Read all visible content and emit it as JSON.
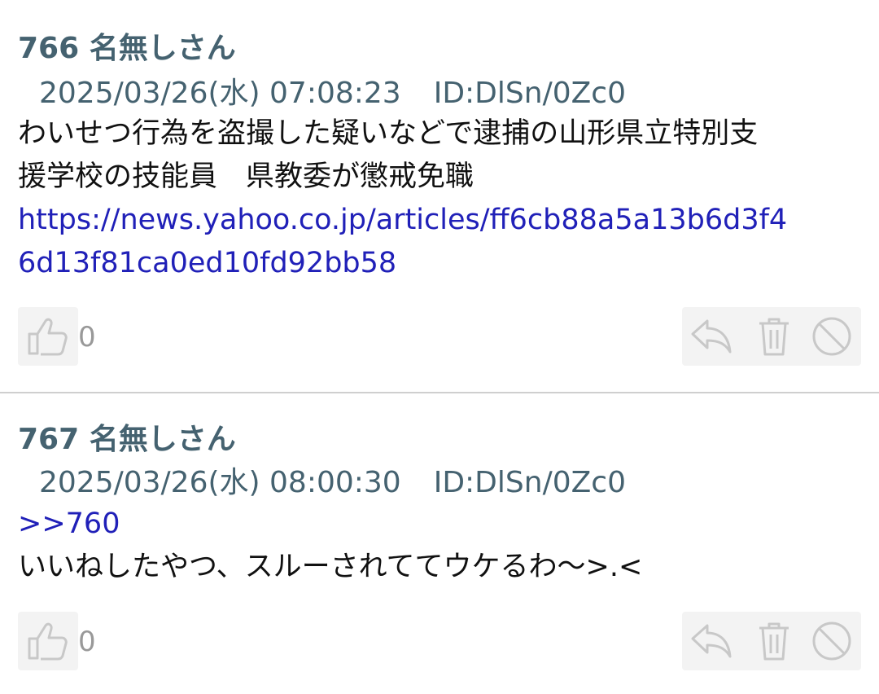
{
  "posts": [
    {
      "number": "766",
      "name": "名無しさん",
      "date": "2025/03/26(水) 07:08:23",
      "id": "ID:DlSn/0Zc0",
      "body_lines": [
        "わいせつ行為を盗撮した疑いなどで逮捕の山形県立特別支",
        "援学校の技能員　県教委が懲戒免職"
      ],
      "link_lines": [
        "https://news.yahoo.co.jp/articles/ff6cb88a5a13b6d3f4",
        "6d13f81ca0ed10fd92bb58"
      ],
      "likes": "0"
    },
    {
      "number": "767",
      "name": "名無しさん",
      "date": "2025/03/26(水) 08:00:30",
      "id": "ID:DlSn/0Zc0",
      "anchor": ">>760",
      "body_lines": [
        "いいねしたやつ、スルーされててウケるわ〜>.<"
      ],
      "likes": "0"
    }
  ],
  "icons": {
    "like": "thumbs-up-icon",
    "reply": "reply-icon",
    "delete": "trash-icon",
    "block": "block-icon"
  },
  "colors": {
    "header": "#456270",
    "link": "#2020b8",
    "icon": "#cccccc",
    "action_bg": "#f3f3f3",
    "divider": "#cfcfcf"
  }
}
